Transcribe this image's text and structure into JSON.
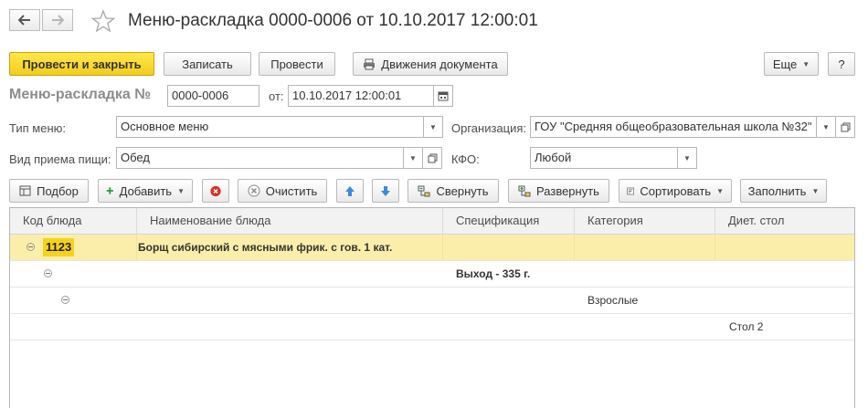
{
  "window": {
    "title": "Меню-раскладка 0000-0006 от 10.10.2017 12:00:01"
  },
  "toolbar": {
    "post_close": "Провести и закрыть",
    "save": "Записать",
    "post": "Провести",
    "movements": "Движения документа",
    "more": "Еще",
    "help": "?"
  },
  "header": {
    "doc_label": "Меню-раскладка №",
    "number": "0000-0006",
    "from_label": "от:",
    "date": "10.10.2017 12:00:01"
  },
  "form": {
    "menu_type_label": "Тип меню:",
    "menu_type_value": "Основное меню",
    "org_label": "Организация:",
    "org_value": "ГОУ \"Средняя общеобразовательная школа №32\"",
    "meal_label": "Вид приема пищи:",
    "meal_value": "Обед",
    "kfo_label": "КФО:",
    "kfo_value": "Любой"
  },
  "table_toolbar": {
    "select": "Подбор",
    "add": "Добавить",
    "clear": "Очистить",
    "collapse": "Свернуть",
    "expand": "Развернуть",
    "sort": "Сортировать",
    "fill": "Заполнить"
  },
  "table": {
    "columns": [
      "Код блюда",
      "Наименование блюда",
      "Спецификация",
      "Категория",
      "Диет. стол"
    ],
    "rows": [
      {
        "code": "1123",
        "name": "Борщ сибирский с мясными фрик. с гов. 1 кат."
      },
      {
        "spec": "Выход - 335 г."
      },
      {
        "category": "Взрослые"
      },
      {
        "diet": "Стол 2"
      }
    ]
  },
  "colors": {
    "primary_button": "#f4cc1b",
    "selected_row": "#fbeeaa",
    "delete_icon": "#d9302a",
    "arrow_icon": "#3d8ad8",
    "add_icon": "#2a9a3a"
  }
}
